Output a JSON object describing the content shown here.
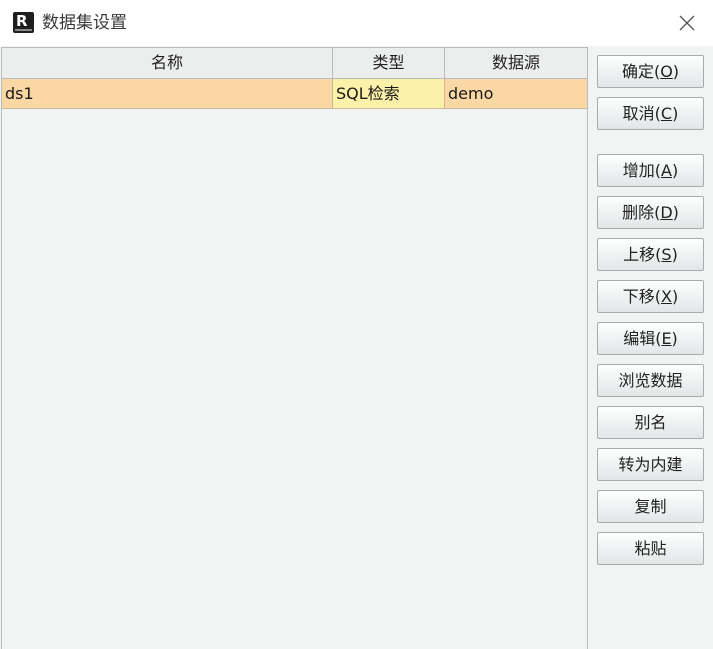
{
  "window": {
    "title": "数据集设置",
    "icon": "report-app-icon",
    "icon_glyph": "R"
  },
  "table": {
    "columns": [
      "名称",
      "类型",
      "数据源"
    ],
    "rows": [
      {
        "name": "ds1",
        "type": "SQL检索",
        "source": "demo",
        "selected": true
      }
    ]
  },
  "buttons": {
    "ok": {
      "label": "确定(",
      "mnemonic": "O",
      "suffix": ")"
    },
    "cancel": {
      "label": "取消(",
      "mnemonic": "C",
      "suffix": ")"
    },
    "add": {
      "label": "增加(",
      "mnemonic": "A",
      "suffix": ")"
    },
    "delete": {
      "label": "删除(",
      "mnemonic": "D",
      "suffix": ")"
    },
    "move_up": {
      "label": "上移(",
      "mnemonic": "S",
      "suffix": ")"
    },
    "move_down": {
      "label": "下移(",
      "mnemonic": "X",
      "suffix": ")"
    },
    "edit": {
      "label": "编辑(",
      "mnemonic": "E",
      "suffix": ")"
    },
    "browse": {
      "label": "浏览数据"
    },
    "alias": {
      "label": "别名"
    },
    "to_builtin": {
      "label": "转为内建"
    },
    "copy": {
      "label": "复制"
    },
    "paste": {
      "label": "粘贴"
    }
  },
  "colors": {
    "selected_row": "#fbd7a3",
    "selected_cell": "#fdf0a8",
    "panel_bg": "#f2f4f3"
  }
}
